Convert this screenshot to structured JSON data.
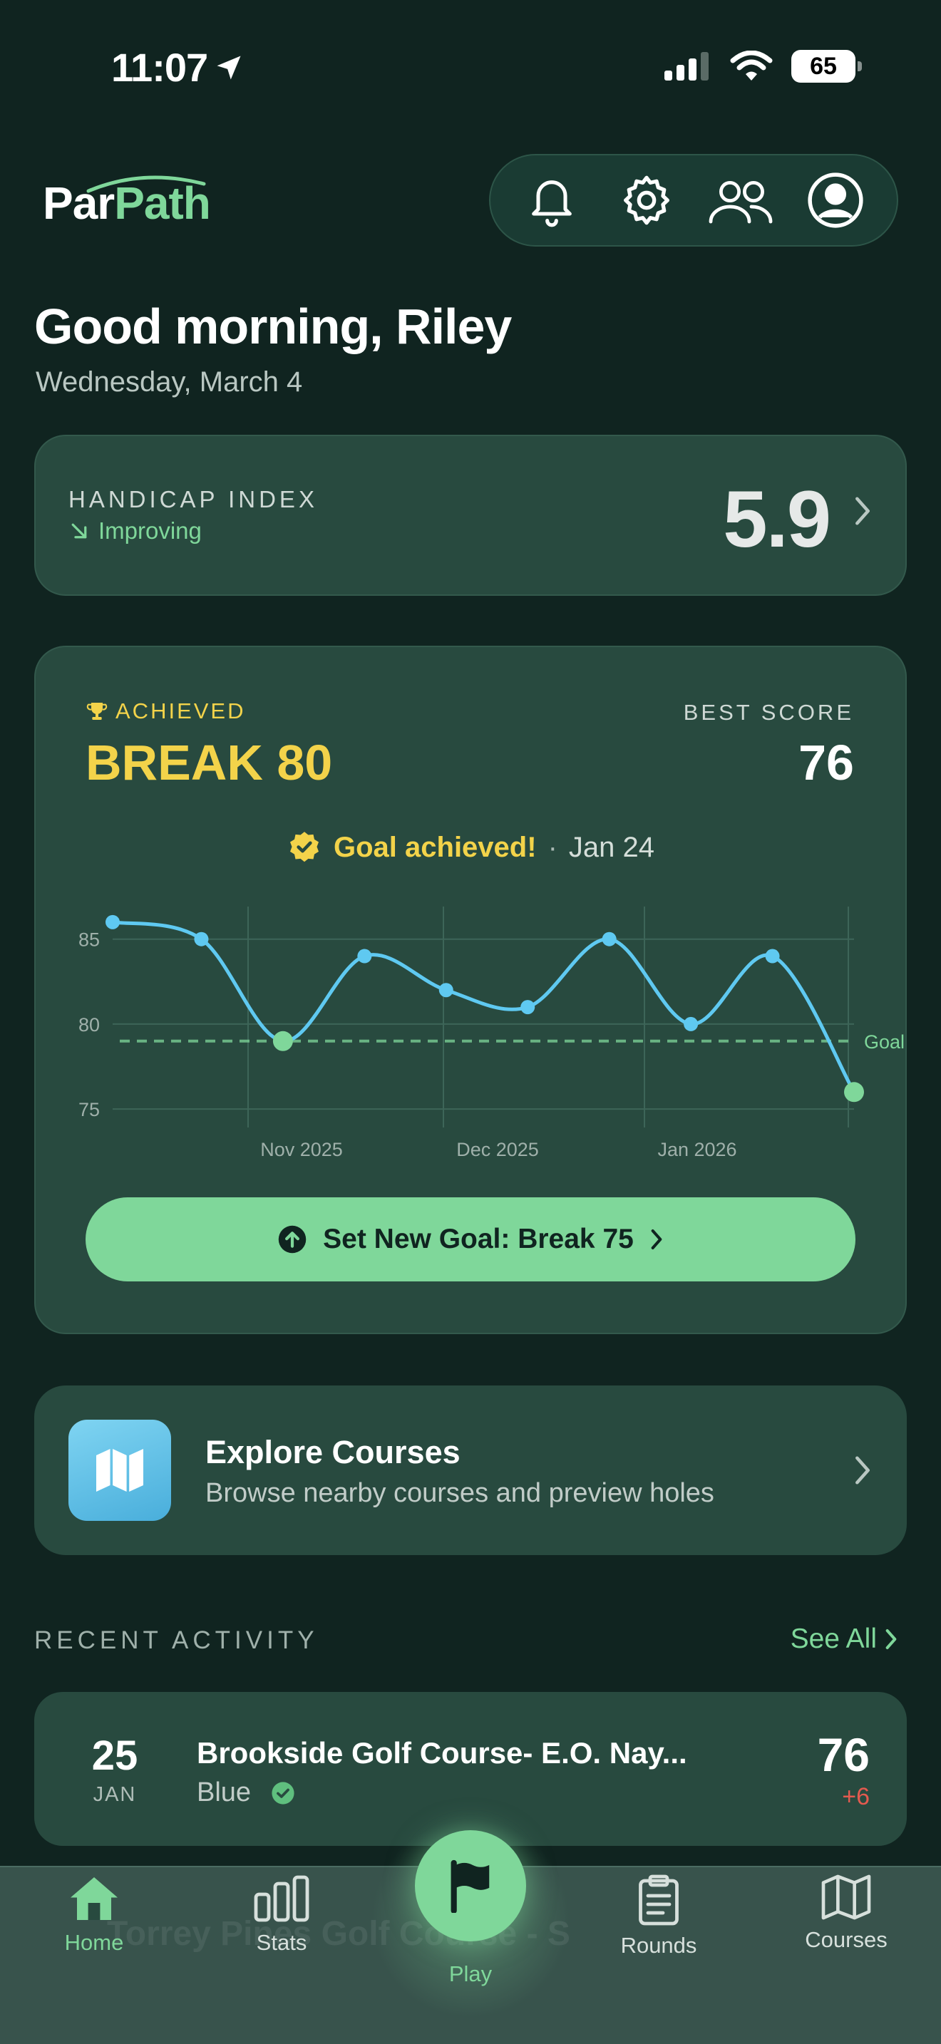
{
  "status_bar": {
    "time": "11:07",
    "battery": "65"
  },
  "header": {
    "logo_part1": "Par",
    "logo_part2": "Path",
    "icons": [
      "bell-icon",
      "gear-icon",
      "friends-icon",
      "profile-icon"
    ]
  },
  "greeting": {
    "title": "Good morning, Riley",
    "date": "Wednesday, March 4"
  },
  "handicap": {
    "label": "HANDICAP INDEX",
    "trend": "Improving",
    "value": "5.9"
  },
  "goal": {
    "status_label": "ACHIEVED",
    "title": "BREAK 80",
    "best_label": "BEST SCORE",
    "best_value": "76",
    "achieved_text": "Goal achieved!",
    "achieved_separator": "·",
    "achieved_date": "Jan 24",
    "button_label": "Set New Goal: Break 75"
  },
  "chart_data": {
    "type": "line",
    "x_ticks": [
      "Nov 2025",
      "Dec 2025",
      "Jan 2026"
    ],
    "y_ticks": [
      "85",
      "80",
      "75"
    ],
    "ylim": [
      74,
      87
    ],
    "goal_label": "Goal",
    "goal_value": 79,
    "series": [
      {
        "values": [
          86,
          85,
          79,
          84,
          82,
          81,
          85,
          80,
          84,
          76
        ]
      }
    ],
    "highlighted_points": [
      2,
      9
    ],
    "line_color": "#5fc9f1",
    "goal_color": "#7fd79a"
  },
  "explore": {
    "title": "Explore Courses",
    "subtitle": "Browse nearby courses and preview holes"
  },
  "recent": {
    "label": "RECENT ACTIVITY",
    "see_all": "See All",
    "rounds": [
      {
        "day": "25",
        "month": "JAN",
        "course": "Brookside Golf Course- E.O. Nay...",
        "tee": "Blue",
        "score": "76",
        "diff": "+6"
      }
    ],
    "behind_tabbar_text": "Torrey Pines Golf Course - S"
  },
  "tabbar": {
    "home": "Home",
    "stats": "Stats",
    "play": "Play",
    "rounds": "Rounds",
    "courses": "Courses"
  },
  "colors": {
    "accent": "#7fd79a",
    "gold": "#f3d34a",
    "background": "#102420",
    "card": "#284a3f"
  }
}
